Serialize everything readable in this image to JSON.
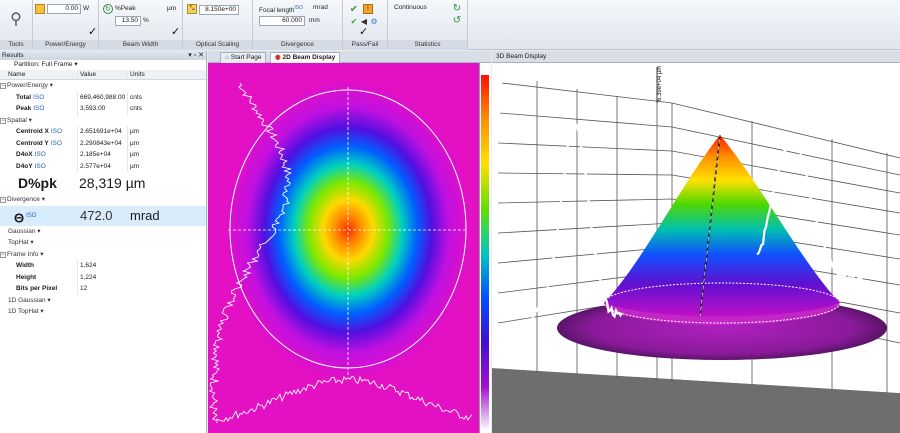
{
  "ribbon": {
    "tools_label": "Tools",
    "power_energy": {
      "label": "Power/Energy",
      "value": "0.00",
      "unit": "W"
    },
    "beam_width": {
      "label": "Beam Width",
      "method": "%Peak",
      "unit": "µm",
      "value": "13.50",
      "value_unit": "%"
    },
    "optical_scaling": {
      "label": "Optical Scaling",
      "value": "8.150e+00"
    },
    "divergence": {
      "label": "Divergence",
      "focal_length_label": "Focal length",
      "focal_iso": "ISO",
      "unit": "mrad",
      "value": "60.000",
      "value_unit": "mm"
    },
    "pass_fail": {
      "label": "Pass/Fail"
    },
    "statistics": {
      "label": "Statistics",
      "mode": "Continuous"
    }
  },
  "results": {
    "title": "Results",
    "partition": "Partition: Full Frame",
    "columns": {
      "name": "Name",
      "value": "Value",
      "units": "Units"
    },
    "power_energy": {
      "section": "Power/Energy",
      "total": {
        "name": "Total",
        "iso": "ISO",
        "value": "669,460,988.00",
        "unit": "cnts"
      },
      "peak": {
        "name": "Peak",
        "iso": "ISO",
        "value": "3,593.00",
        "unit": "cnts"
      }
    },
    "spatial": {
      "section": "Spatial",
      "cx": {
        "name": "Centroid X",
        "iso": "ISO",
        "value": "2.651691e+04",
        "unit": "µm"
      },
      "cy": {
        "name": "Centroid Y",
        "iso": "ISO",
        "value": "2.290843e+04",
        "unit": "µm"
      },
      "d4ox": {
        "name": "D4oX",
        "iso": "ISO",
        "value": "2.185e+04",
        "unit": "µm"
      },
      "d4oy": {
        "name": "D4oY",
        "iso": "ISO",
        "value": "2.577e+04",
        "unit": "µm"
      },
      "dpk": {
        "name": "D%pk",
        "value": "28,319",
        "unit": "µm"
      }
    },
    "divergence": {
      "section": "Divergence",
      "theta": {
        "name": "Θ",
        "iso": "ISO",
        "value": "472.0",
        "unit": "mrad"
      }
    },
    "gaussian": "Gaussian",
    "tophat": "TopHat",
    "frame_info": {
      "section": "Frame Info",
      "width": {
        "name": "Width",
        "value": "1,624"
      },
      "height": {
        "name": "Height",
        "value": "1,224"
      },
      "bpp": {
        "name": "Bits per Pixel",
        "value": "12"
      }
    },
    "gaussian_1d": "1D Gaussian",
    "tophat_1d": "1D TopHat"
  },
  "tabs": {
    "start": "Start Page",
    "beam2d": "2D Beam Display"
  },
  "panel3d": {
    "title": "3D Beam Display",
    "marker": "6.39e+04 µm"
  },
  "colors": {
    "ribbon_bg": "#e2e8ef",
    "selected_row": "#d9ecfb",
    "iso_blue": "#1f62c8",
    "accent_green": "#3aa03a"
  }
}
